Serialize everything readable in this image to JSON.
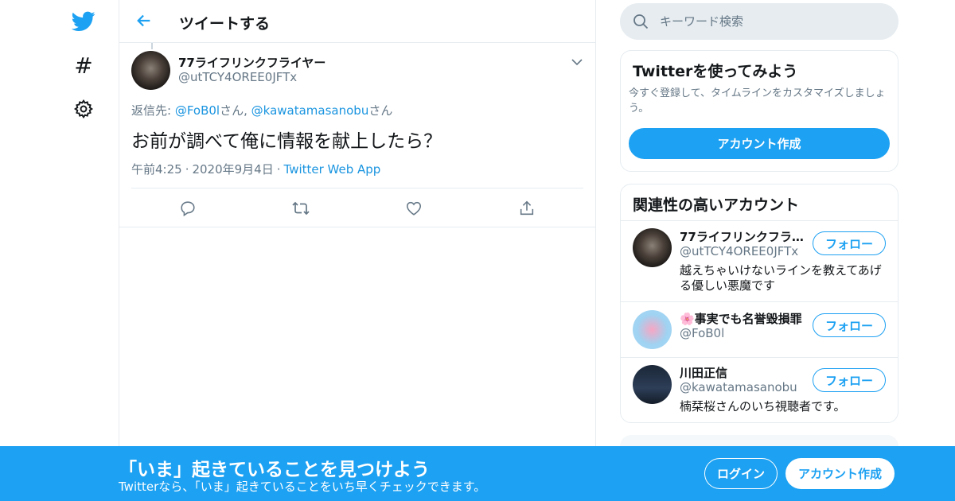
{
  "colors": {
    "accent": "#1da1f2",
    "border": "#e6ecf0",
    "muted": "#657786",
    "text": "#14171a"
  },
  "nav": {
    "items": [
      {
        "icon": "twitter-bird-icon"
      },
      {
        "icon": "hashtag-icon",
        "glyph": "#"
      },
      {
        "icon": "gear-icon"
      }
    ]
  },
  "header": {
    "title": "ツイートする"
  },
  "tweet": {
    "author_name": "77ライフリンクフライヤー",
    "author_handle": "@utTCY4OREE0JFTx",
    "reply_label": "返信先: ",
    "reply_mentions": [
      {
        "handle": "@FoB0l",
        "suffix": "さん, "
      },
      {
        "handle": "@kawatamasanobu",
        "suffix": "さん"
      }
    ],
    "text": "お前が調べて俺に情報を献上したら？",
    "time": "午前4:25",
    "date": "2020年9月4日",
    "source": "Twitter Web App",
    "separator": "·"
  },
  "search": {
    "placeholder": "キーワード検索"
  },
  "signup_card": {
    "title": "Twitterを使ってみよう",
    "description": "今すぐ登録して、タイムラインをカスタマイズしましょう。",
    "button": "アカウント作成"
  },
  "related": {
    "title": "関連性の高いアカウント",
    "follow_label": "フォロー",
    "accounts": [
      {
        "name": "77ライフリンクフライヤー",
        "handle": "@utTCY4OREE0JFTx",
        "bio": "越えちゃいけないラインを教えてあげる優しい悪魔です"
      },
      {
        "name": "🌸事実でも名誉毀損罪",
        "handle": "@FoB0l",
        "bio": ""
      },
      {
        "name": "川田正信",
        "handle": "@kawatamasanobu",
        "bio": "楠栞桜さんのいち視聴者です。"
      }
    ]
  },
  "banner": {
    "title": "「いま」起きていることを見つけよう",
    "subtitle": "Twitterなら、「いま」起きていることをいち早くチェックできます。",
    "login": "ログイン",
    "signup": "アカウント作成"
  }
}
